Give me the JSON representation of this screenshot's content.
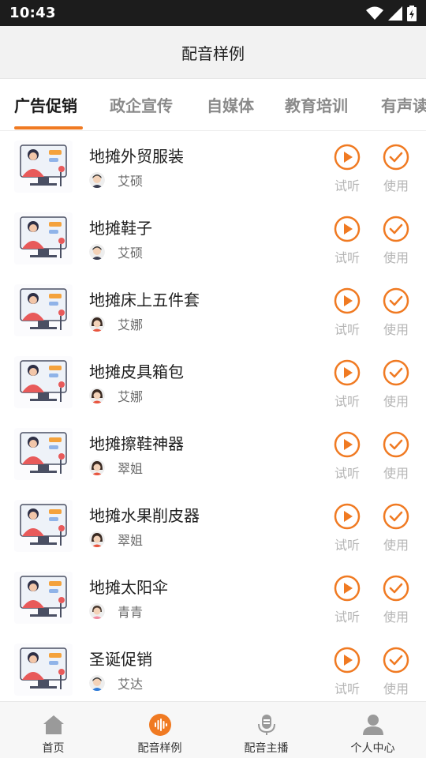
{
  "status_bar": {
    "time": "10:43"
  },
  "header": {
    "title": "配音样例"
  },
  "tabs": [
    {
      "label": "广告促销",
      "active": true
    },
    {
      "label": "政企宣传",
      "active": false
    },
    {
      "label": "自媒体",
      "active": false
    },
    {
      "label": "教育培训",
      "active": false
    },
    {
      "label": "有声读",
      "active": false
    }
  ],
  "actions": {
    "listen_label": "试听",
    "use_label": "使用"
  },
  "items": [
    {
      "title": "地摊外贸服装",
      "speaker": "艾硕",
      "speaker_gender": "male"
    },
    {
      "title": "地摊鞋子",
      "speaker": "艾硕",
      "speaker_gender": "male"
    },
    {
      "title": "地摊床上五件套",
      "speaker": "艾娜",
      "speaker_gender": "female"
    },
    {
      "title": "地摊皮具箱包",
      "speaker": "艾娜",
      "speaker_gender": "female"
    },
    {
      "title": "地摊擦鞋神器",
      "speaker": "翠姐",
      "speaker_gender": "female"
    },
    {
      "title": "地摊水果削皮器",
      "speaker": "翠姐",
      "speaker_gender": "female"
    },
    {
      "title": "地摊太阳伞",
      "speaker": "青青",
      "speaker_gender": "female"
    },
    {
      "title": "圣诞促销",
      "speaker": "艾达",
      "speaker_gender": "male"
    }
  ],
  "bottom_nav": [
    {
      "label": "首页",
      "icon": "home-icon",
      "active": false
    },
    {
      "label": "配音样例",
      "icon": "soundwave-icon",
      "active": true
    },
    {
      "label": "配音主播",
      "icon": "anchor-mic-icon",
      "active": false
    },
    {
      "label": "个人中心",
      "icon": "person-icon",
      "active": false
    }
  ],
  "colors": {
    "accent": "#f07a22",
    "muted": "#b5b5b5",
    "nav_icon": "#9a9a9a"
  }
}
